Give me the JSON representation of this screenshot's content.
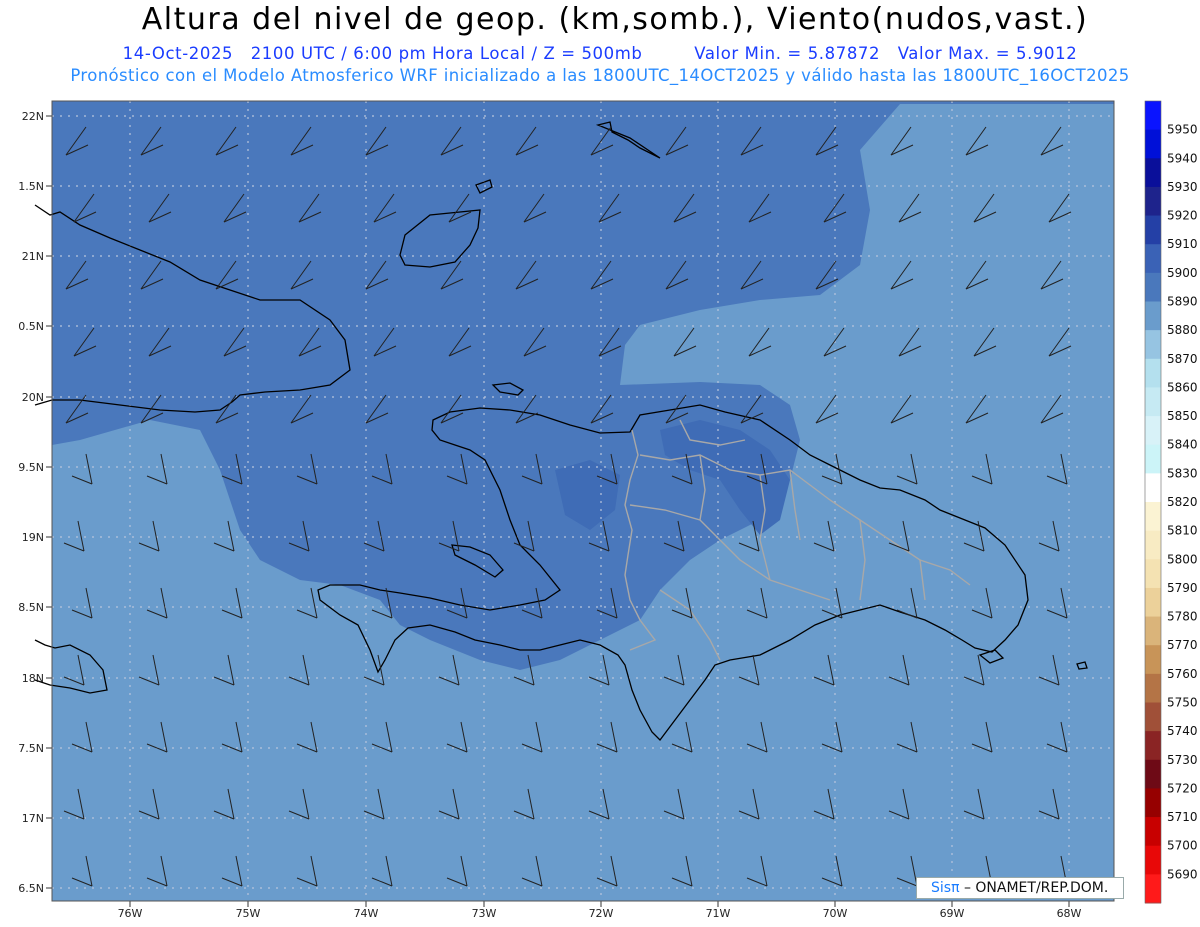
{
  "header": {
    "title": "Altura del nivel de geop. (km,somb.), Viento(nudos,vast.)",
    "date": "14-Oct-2025",
    "time": "2100 UTC / 6:00 pm Hora Local / Z = 500mb",
    "min": "Valor Min. = 5.87872",
    "max": "Valor Max. = 5.9012",
    "model_line": "Pronóstico con el Modelo Atmosferico WRF inicializado a las 1800UTC_14OCT2025 y válido hasta las  1800UTC_16OCT2025"
  },
  "axes": {
    "lat_labels": [
      "22N",
      "1.5N",
      "21N",
      "0.5N",
      "20N",
      "9.5N",
      "19N",
      "8.5N",
      "18N",
      "7.5N",
      "17N",
      "6.5N"
    ],
    "lon_labels": [
      "76W",
      "75W",
      "74W",
      "73W",
      "72W",
      "71W",
      "70W",
      "69W",
      "68W"
    ]
  },
  "colorbar": {
    "levels": [
      {
        "label": "5950",
        "color": "#0a14ff"
      },
      {
        "label": "5940",
        "color": "#0010d8"
      },
      {
        "label": "5930",
        "color": "#0a0f9a"
      },
      {
        "label": "5920",
        "color": "#1e238c"
      },
      {
        "label": "5910",
        "color": "#2440a6"
      },
      {
        "label": "5900",
        "color": "#3a62b6"
      },
      {
        "label": "5890",
        "color": "#4a78bc"
      },
      {
        "label": "5880",
        "color": "#6a9ccc"
      },
      {
        "label": "5870",
        "color": "#96c4e2"
      },
      {
        "label": "5860",
        "color": "#b4e0ee"
      },
      {
        "label": "5850",
        "color": "#c6eaf3"
      },
      {
        "label": "5840",
        "color": "#d8f2f8"
      },
      {
        "label": "5830",
        "color": "#ccf4f8"
      },
      {
        "label": "5820",
        "color": "#ffffff"
      },
      {
        "label": "5810",
        "color": "#fbf3d3"
      },
      {
        "label": "5800",
        "color": "#f8ebc3"
      },
      {
        "label": "5790",
        "color": "#f4e2b2"
      },
      {
        "label": "5780",
        "color": "#ecd19a"
      },
      {
        "label": "5770",
        "color": "#dab47a"
      },
      {
        "label": "5760",
        "color": "#c89458"
      },
      {
        "label": "5750",
        "color": "#b47446"
      },
      {
        "label": "5740",
        "color": "#a05038"
      },
      {
        "label": "5730",
        "color": "#8a2424"
      },
      {
        "label": "5720",
        "color": "#6e0a16"
      },
      {
        "label": "5710",
        "color": "#960000"
      },
      {
        "label": "5700",
        "color": "#c80000"
      },
      {
        "label": "5690",
        "color": "#e80808"
      },
      {
        "label": "",
        "color": "#ff1a1a"
      }
    ]
  },
  "credit": {
    "part1": "Sisπ",
    "part2": "– ONAMET/REP.DOM."
  },
  "colors": {
    "field_low": "#6a9ccc",
    "field_high": "#4a78bc",
    "coast": "#000000",
    "provinces": "#a8a8a8",
    "grid": "#b8c4dc"
  }
}
